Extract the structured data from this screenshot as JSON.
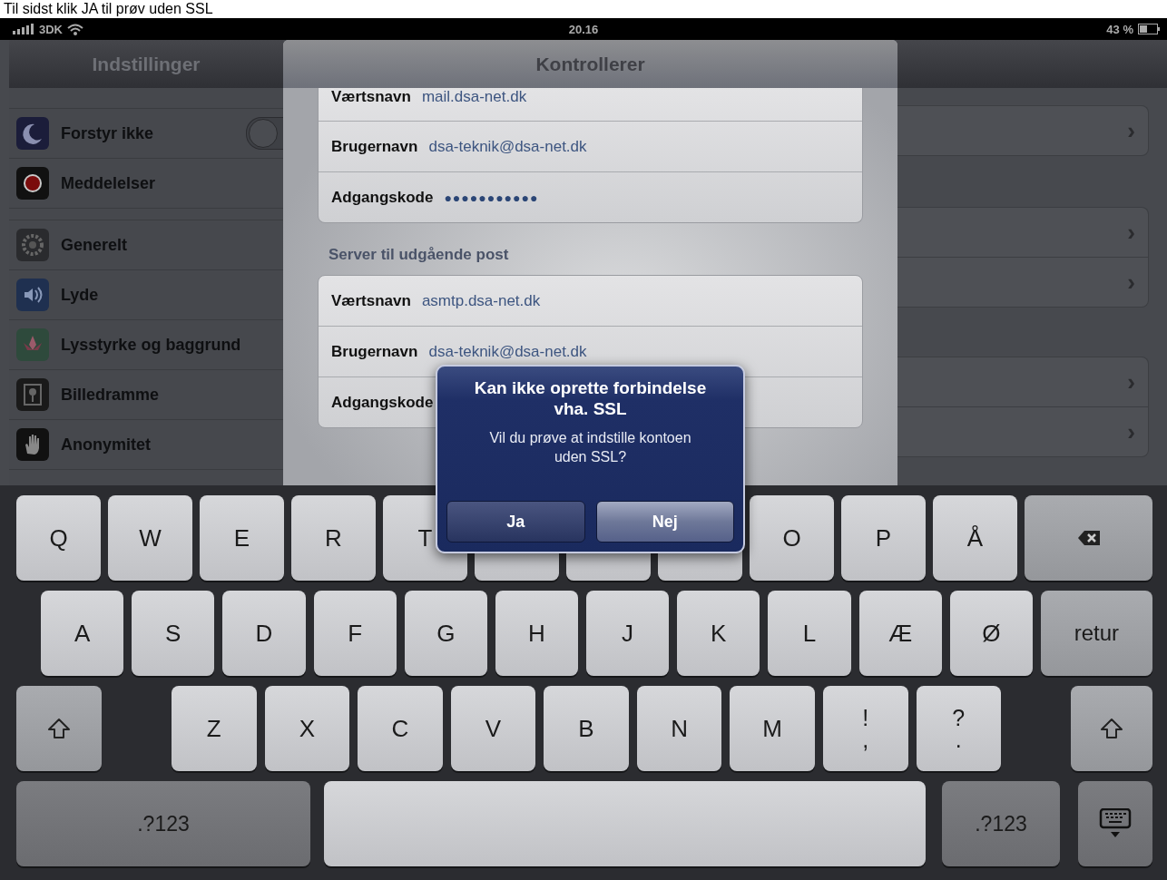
{
  "caption": "Til sidst klik JA til prøv uden SSL",
  "status_bar": {
    "carrier": "3DK",
    "time": "20.16",
    "battery": "43 %"
  },
  "sidebar": {
    "title": "Indstillinger",
    "groups": [
      {
        "items": [
          {
            "label": "Forstyr ikke",
            "kind": "toggle",
            "on": false
          },
          {
            "label": "Meddelelser",
            "kind": "link"
          }
        ]
      },
      {
        "items": [
          {
            "label": "Generelt",
            "kind": "link"
          },
          {
            "label": "Lyde",
            "kind": "link"
          },
          {
            "label": "Lysstyrke og baggrund",
            "kind": "link"
          },
          {
            "label": "Billedramme",
            "kind": "link"
          },
          {
            "label": "Anonymitet",
            "kind": "link"
          }
        ]
      }
    ]
  },
  "sheet": {
    "title": "Kontrollerer",
    "groups": [
      {
        "rows": [
          {
            "label": "Værtsnavn",
            "value": "mail.dsa-net.dk"
          },
          {
            "label": "Brugernavn",
            "value": "dsa-teknik@dsa-net.dk"
          },
          {
            "label": "Adgangskode",
            "value": "●●●●●●●●●●●",
            "kind": "password"
          }
        ]
      },
      {
        "header": "Server til udgående post",
        "rows": [
          {
            "label": "Værtsnavn",
            "value": "asmtp.dsa-net.dk"
          },
          {
            "label": "Brugernavn",
            "value": "dsa-teknik@dsa-net.dk"
          },
          {
            "label": "Adgangskode"
          }
        ]
      }
    ]
  },
  "background_pane": {
    "groups": [
      {
        "rows": [
          {
            "chevron": "›"
          }
        ]
      },
      {
        "rows": [
          {
            "chevron": "›"
          },
          {
            "chevron": "›"
          }
        ]
      },
      {
        "rows": [
          {
            "chevron": "›"
          },
          {
            "chevron": "›"
          }
        ]
      }
    ]
  },
  "alert": {
    "title": "Kan ikke oprette forbindelse vha. SSL",
    "message": "Vil du prøve at indstille kontoen uden SSL?",
    "buttons": [
      {
        "label": "Ja",
        "selected": false
      },
      {
        "label": "Nej",
        "selected": true
      }
    ]
  },
  "keyboard": {
    "rows": [
      {
        "keys": [
          {
            "kind": "letter",
            "label": "Q"
          },
          {
            "kind": "letter",
            "label": "W"
          },
          {
            "kind": "letter",
            "label": "E"
          },
          {
            "kind": "letter",
            "label": "R"
          },
          {
            "kind": "letter",
            "label": "T"
          },
          {
            "kind": "covered"
          },
          {
            "kind": "covered"
          },
          {
            "kind": "covered"
          },
          {
            "kind": "letter",
            "label": "O"
          },
          {
            "kind": "letter",
            "label": "P"
          },
          {
            "kind": "letter",
            "label": "Å"
          },
          {
            "kind": "backspace"
          }
        ]
      },
      {
        "keys": [
          {
            "kind": "letter",
            "label": "A"
          },
          {
            "kind": "letter",
            "label": "S"
          },
          {
            "kind": "letter",
            "label": "D"
          },
          {
            "kind": "letter",
            "label": "F"
          },
          {
            "kind": "letter",
            "label": "G"
          },
          {
            "kind": "letter",
            "label": "H"
          },
          {
            "kind": "letter",
            "label": "J"
          },
          {
            "kind": "letter",
            "label": "K"
          },
          {
            "kind": "letter",
            "label": "L"
          },
          {
            "kind": "letter",
            "label": "Æ"
          },
          {
            "kind": "letter",
            "label": "Ø"
          },
          {
            "kind": "return",
            "label": "retur"
          }
        ]
      },
      {
        "keys": [
          {
            "kind": "shift"
          },
          {
            "kind": "letter",
            "label": "Z"
          },
          {
            "kind": "letter",
            "label": "X"
          },
          {
            "kind": "letter",
            "label": "C"
          },
          {
            "kind": "letter",
            "label": "V"
          },
          {
            "kind": "letter",
            "label": "B"
          },
          {
            "kind": "letter",
            "label": "N"
          },
          {
            "kind": "letter",
            "label": "M"
          },
          {
            "kind": "letter",
            "label": "!",
            "sub": ","
          },
          {
            "kind": "letter",
            "label": "?",
            "sub": "."
          },
          {
            "kind": "shift"
          }
        ]
      },
      {
        "keys": [
          {
            "kind": "mode",
            "label": ".?123"
          },
          {
            "kind": "space"
          },
          {
            "kind": "mode",
            "label": ".?123"
          },
          {
            "kind": "dismiss"
          }
        ]
      }
    ]
  }
}
